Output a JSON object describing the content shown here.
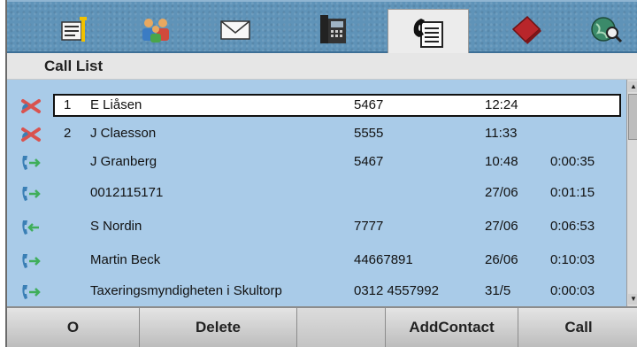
{
  "tabs": [
    {
      "id": "settings",
      "icon": "settings-icon"
    },
    {
      "id": "contacts",
      "icon": "contacts-group-icon"
    },
    {
      "id": "messages",
      "icon": "envelope-icon"
    },
    {
      "id": "phone",
      "icon": "desk-phone-icon"
    },
    {
      "id": "call-list",
      "icon": "call-list-icon",
      "active": true
    },
    {
      "id": "phonebook",
      "icon": "red-book-icon"
    },
    {
      "id": "network",
      "icon": "globe-search-icon"
    }
  ],
  "title": "Call List",
  "calls": [
    {
      "type": "missed",
      "icon": "missed-call-icon",
      "count": "1",
      "name": "E Liåsen",
      "number": "5467",
      "time": "12:24",
      "duration": "",
      "selected": true
    },
    {
      "type": "missed",
      "icon": "missed-call-icon",
      "count": "2",
      "name": "J Claesson",
      "number": "5555",
      "time": "11:33",
      "duration": ""
    },
    {
      "type": "outgoing",
      "icon": "outgoing-call-icon",
      "count": "",
      "name": "J Granberg",
      "number": "5467",
      "time": "10:48",
      "duration": "0:00:35"
    },
    {
      "type": "outgoing",
      "icon": "outgoing-call-icon",
      "count": "",
      "name": "0012115171",
      "number": "",
      "time": "27/06",
      "duration": "0:01:15"
    },
    {
      "type": "incoming",
      "icon": "incoming-call-icon",
      "count": "",
      "name": "S Nordin",
      "number": "7777",
      "time": "27/06",
      "duration": "0:06:53"
    },
    {
      "type": "outgoing",
      "icon": "outgoing-call-icon",
      "count": "",
      "name": "Martin Beck",
      "number": "44667891",
      "time": "26/06",
      "duration": "0:10:03"
    },
    {
      "type": "outgoing",
      "icon": "outgoing-call-icon",
      "count": "",
      "name": "Taxeringsmyndigheten i Skultorp",
      "number": "0312 4557992",
      "time": "31/5",
      "duration": "0:00:03"
    }
  ],
  "softkeys": {
    "home": "O",
    "delete": "Delete",
    "empty": "",
    "add_contact": "AddContact",
    "call": "Call"
  },
  "colors": {
    "tab_bar": "#5f93b8",
    "list_background": "#a9cbe8",
    "missed": "#d9534f",
    "call_icon": "#3a7fb5"
  }
}
